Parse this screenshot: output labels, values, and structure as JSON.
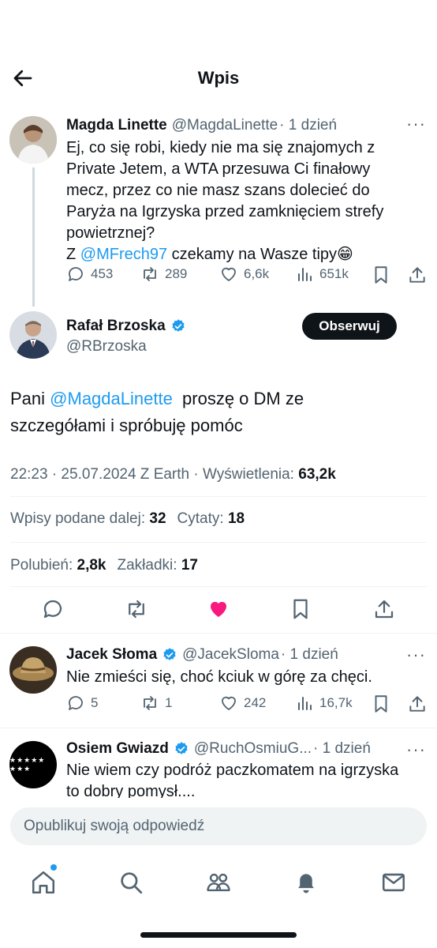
{
  "header": {
    "title": "Wpis"
  },
  "parent_tweet": {
    "name": "Magda Linette",
    "handle": "@MagdaLinette",
    "time": "· 1 dzień",
    "text_line1": "Ej, co się robi, kiedy nie ma się znajomych z",
    "text_line2": "Private Jetem, a WTA przesuwa Ci finałowy",
    "text_line3": "mecz, przez co nie masz szans dolecieć do",
    "text_line4": "Paryża na Igrzyska przed zamknięciem strefy",
    "text_line5": "powietrznej?",
    "text_line6_pre": "Z ",
    "text_line6_mention": "@MFrech97",
    "text_line6_post": " czekamy na Wasze tipy😁",
    "replies": "453",
    "reposts": "289",
    "likes": "6,6k",
    "views": "651k"
  },
  "main_tweet": {
    "name": "Rafał Brzoska",
    "handle": "@RBrzoska",
    "follow_label": "Obserwuj",
    "text_pre": "Pani ",
    "text_mention": "@MagdaLinette",
    "text_post": "  proszę o DM ze",
    "text_line2": "szczegółami i spróbuję pomóc",
    "meta_prefix": "22:23 · 25.07.2024 Z Earth · Wyświetlenia: ",
    "meta_views": "63,2k",
    "reposts_label": "Wpisy podane dalej: ",
    "reposts_value": "32",
    "quotes_label": "Cytaty: ",
    "quotes_value": "18",
    "likes_label": "Polubień: ",
    "likes_value": "2,8k",
    "bookmarks_label": "Zakładki: ",
    "bookmarks_value": "17"
  },
  "replies": [
    {
      "name": "Jacek Słoma",
      "handle": "@JacekSloma",
      "time": "· 1 dzień",
      "text": "Nie zmieści się, choć kciuk w górę za chęci.",
      "replies": "5",
      "reposts": "1",
      "likes": "242",
      "views": "16,7k"
    },
    {
      "name": "Osiem Gwiazd",
      "handle": "@RuchOsmiuG...",
      "time": "· 1 dzień",
      "text_line1": "Nie wiem czy podróż paczkomatem na igrzyska",
      "text_line2": "to dobry pomysł....",
      "avatar_stars": "★★★★★ ★★★"
    }
  ],
  "reply_box": {
    "placeholder": "Opublikuj swoją odpowiedź"
  },
  "colors": {
    "accent": "#1d9bf0",
    "like": "#f91880",
    "text": "#0f1419",
    "muted": "#536471"
  },
  "icons": [
    "back-arrow-icon",
    "reply-icon",
    "repost-icon",
    "heart-icon",
    "views-icon",
    "bookmark-icon",
    "share-icon",
    "verified-icon",
    "home-icon",
    "search-icon",
    "communities-icon",
    "bell-icon",
    "mail-icon",
    "more-icon"
  ]
}
